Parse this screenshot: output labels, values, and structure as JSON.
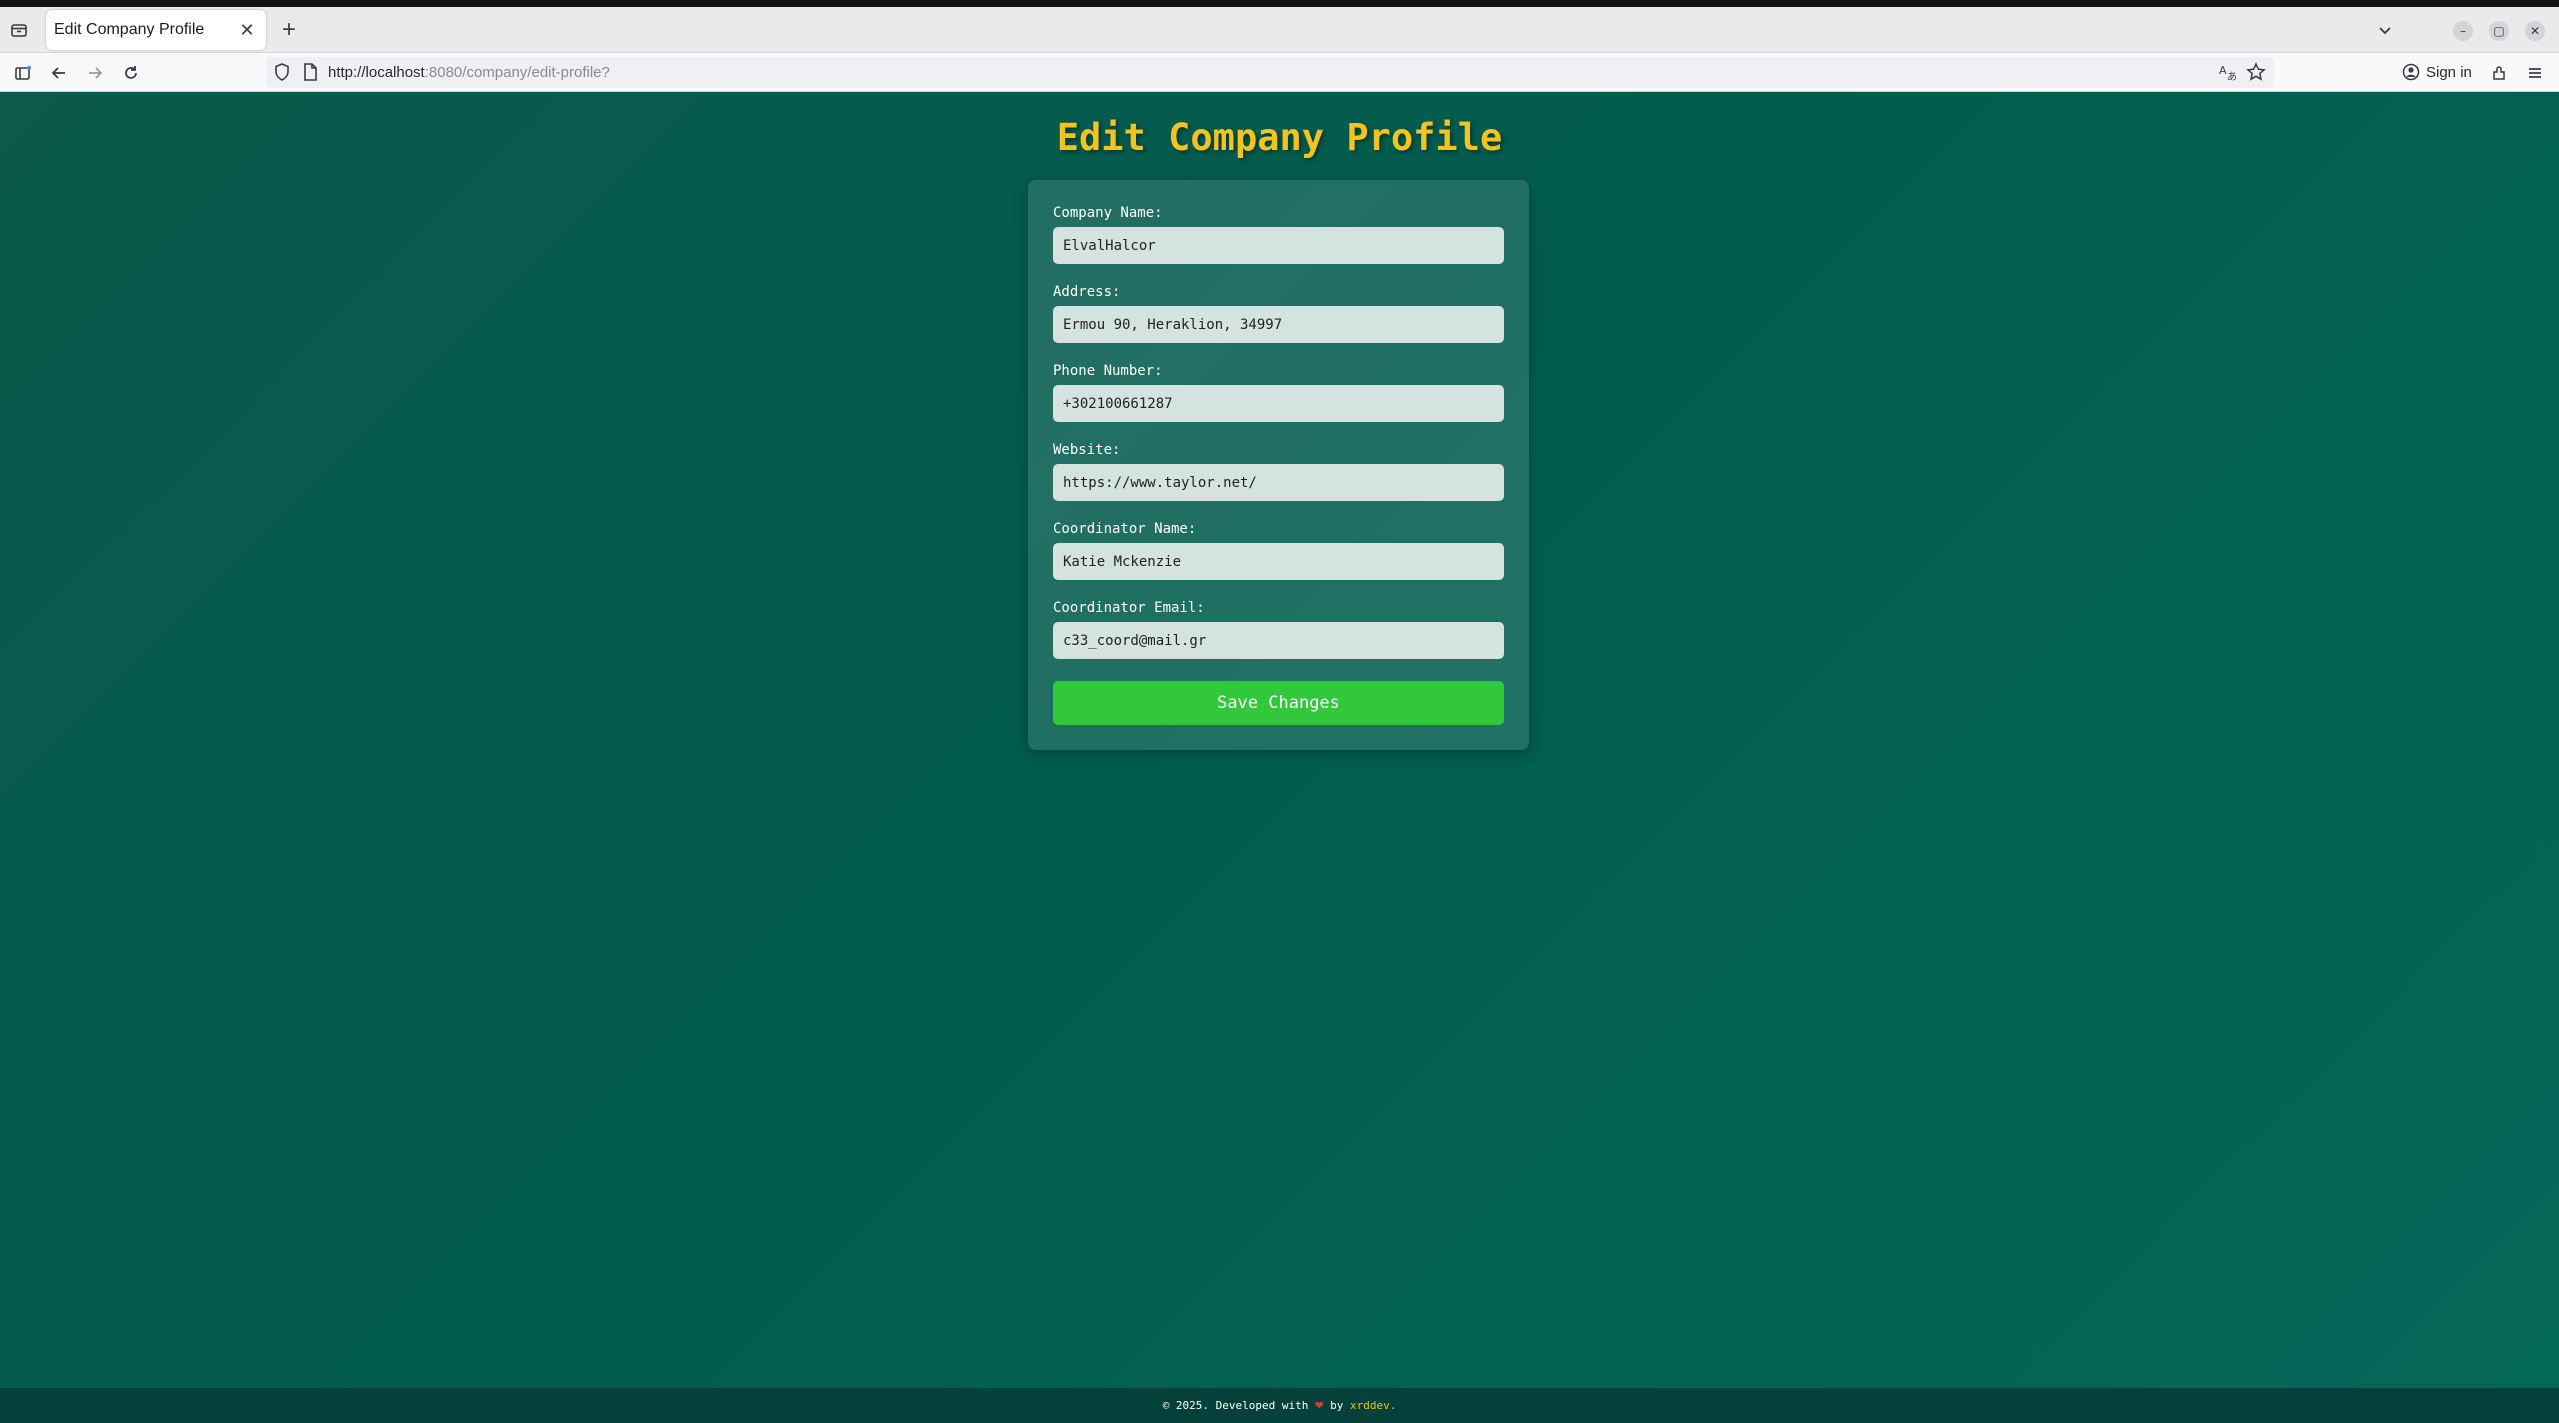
{
  "browser": {
    "tab": {
      "title": "Edit Company Profile",
      "close_glyph": "✕"
    },
    "new_tab_glyph": "+",
    "window_buttons": {
      "minimize": "–",
      "restore": "▢",
      "close": "✕"
    },
    "url": {
      "host": "http://localhost",
      "path": ":8080/company/edit-profile?"
    },
    "signin_label": "Sign in",
    "icons": [
      "tab-list-icon",
      "back-icon",
      "forward-icon",
      "reload-icon",
      "shield-icon",
      "page-icon",
      "translate-icon",
      "star-icon",
      "account-icon",
      "extensions-icon",
      "menu-icon"
    ]
  },
  "page": {
    "title": "Edit Company Profile",
    "accent_color": "#f3c31f",
    "background_color": "#025c4e",
    "button_color": "#32c83c"
  },
  "form": {
    "fields": [
      {
        "label": "Company Name:",
        "value": "ElvalHalcor"
      },
      {
        "label": "Address:",
        "value": "Ermou 90, Heraklion, 34997"
      },
      {
        "label": "Phone Number:",
        "value": "+302100661287"
      },
      {
        "label": "Website:",
        "value": "https://www.taylor.net/"
      },
      {
        "label": "Coordinator Name:",
        "value": "Katie Mckenzie"
      },
      {
        "label": "Coordinator Email:",
        "value": "c33_coord@mail.gr"
      }
    ],
    "submit_label": "Save Changes"
  },
  "footer": {
    "prefix": "© 2025. Developed with",
    "heart": "❤",
    "by": "by",
    "brand": "xrddev."
  }
}
